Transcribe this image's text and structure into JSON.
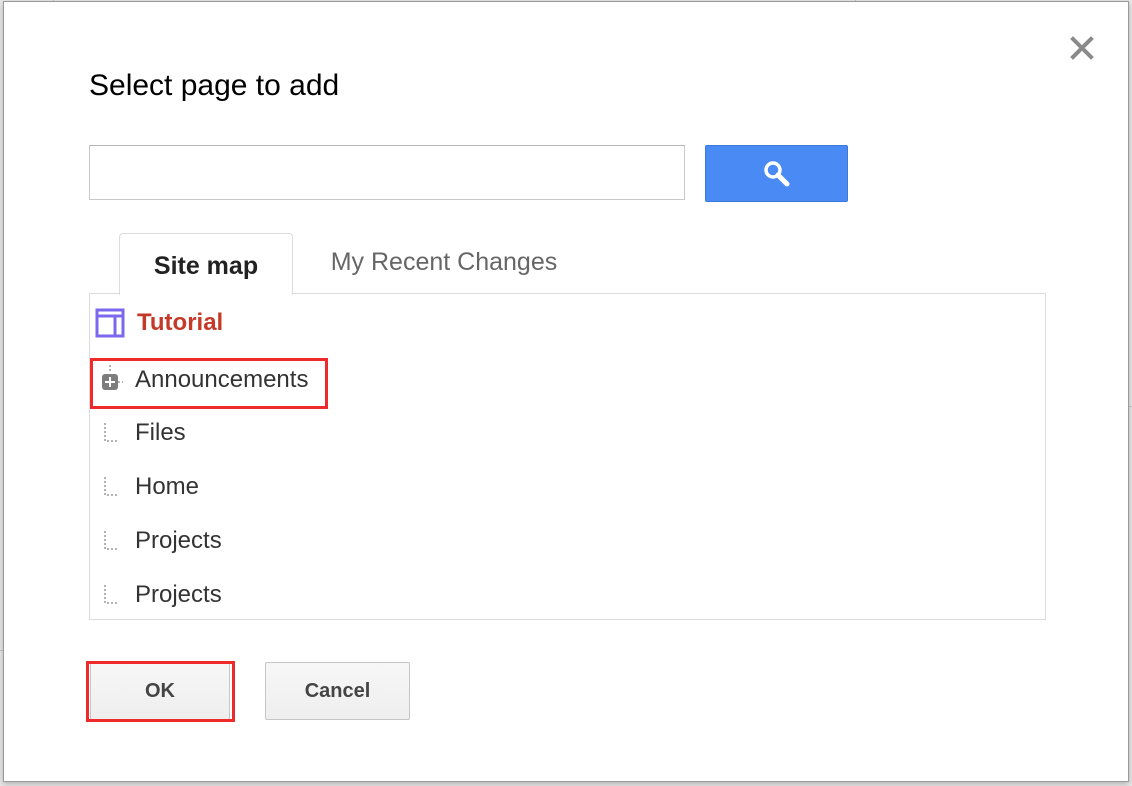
{
  "dialog": {
    "title": "Select page to add",
    "close_icon": "close-icon"
  },
  "search": {
    "value": "",
    "placeholder": "",
    "button_icon": "magnifier-icon",
    "button_color": "#4a8af4"
  },
  "tabs": [
    {
      "label": "Site map",
      "active": true
    },
    {
      "label": "My Recent Changes",
      "active": false
    }
  ],
  "sitemap": {
    "root": {
      "label": "Tutorial",
      "icon": "site-layout-icon",
      "color": "#c53929"
    },
    "items": [
      {
        "label": "Announcements",
        "icon": "expand-plus-icon",
        "expandable": true
      },
      {
        "label": "Files",
        "icon": "tree-branch-icon",
        "expandable": false
      },
      {
        "label": "Home",
        "icon": "tree-branch-icon",
        "expandable": false
      },
      {
        "label": "Projects",
        "icon": "tree-branch-icon",
        "expandable": false
      },
      {
        "label": "Projects",
        "icon": "tree-branch-icon",
        "expandable": false
      }
    ]
  },
  "buttons": {
    "ok_label": "OK",
    "cancel_label": "Cancel"
  },
  "annotations": {
    "highlight_color": "#ee2a2a"
  }
}
